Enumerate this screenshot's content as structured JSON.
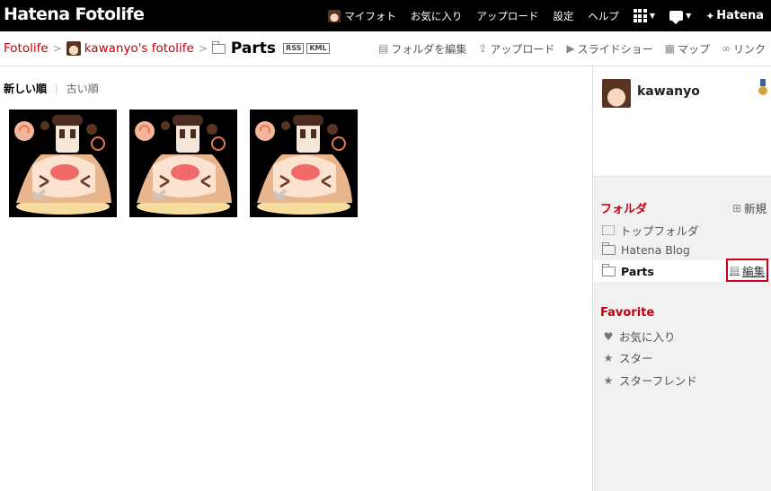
{
  "topbar": {
    "logo": "Hatena Fotolife",
    "nav": {
      "myfoto": "マイフォト",
      "favorites": "お気に入り",
      "upload": "アップロード",
      "settings": "設定",
      "help": "ヘルプ",
      "brand": "Hatena"
    }
  },
  "breadcrumb": {
    "root": "Fotolife",
    "separator": ">",
    "user": "kawanyo's fotolife",
    "current": "Parts",
    "rss": "RSS",
    "kml": "KML"
  },
  "actions": {
    "edit_folder": "フォルダを編集",
    "upload": "アップロード",
    "slideshow": "スライドショー",
    "map": "マップ",
    "link": "リンク"
  },
  "sort": {
    "newest": "新しい順",
    "oldest": "古い順"
  },
  "thumbnails": [
    {
      "name": "parts-image-1"
    },
    {
      "name": "parts-image-2"
    },
    {
      "name": "parts-image-3"
    }
  ],
  "sidebar": {
    "username": "kawanyo",
    "folder_section": "フォルダ",
    "new_folder": "新規",
    "folders": {
      "top": "トップフォルダ",
      "blog": "Hatena Blog",
      "parts": "Parts"
    },
    "edit": "編集",
    "favorite_section": "Favorite",
    "favorites": {
      "fav": "お気に入り",
      "star": "スター",
      "star_friend": "スターフレンド"
    }
  },
  "colors": {
    "accent": "#c2000f",
    "topbar_bg": "#000000",
    "sidebar_bg": "#f1f1f1",
    "highlight_border": "#d0001c"
  }
}
